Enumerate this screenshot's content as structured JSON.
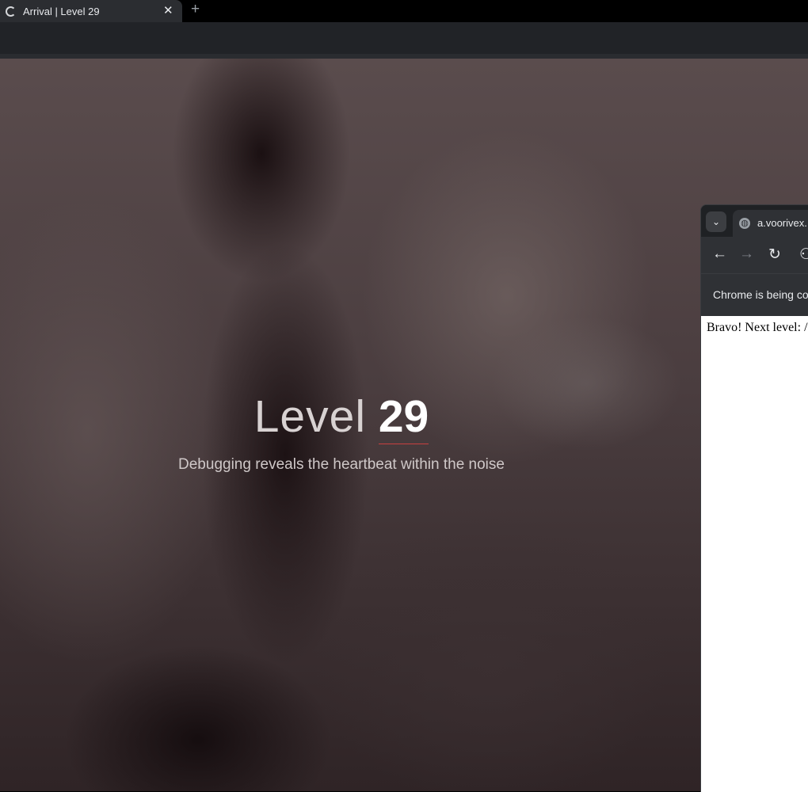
{
  "browser": {
    "tab": {
      "title": "Arrival | Level 29",
      "close_label": "✕"
    },
    "new_tab_label": "+"
  },
  "page": {
    "level_word": "Level",
    "level_number": "29",
    "subtitle": "Debugging reveals the heartbeat within the noise",
    "accent_color": "#c9403f"
  },
  "popup": {
    "tab_search_label": "⌄",
    "tab_title": "a.voorivex.",
    "globe_icon": "globe-icon",
    "back_label": "←",
    "forward_label": "→",
    "reload_label": "↻",
    "site_settings_label": "⚇",
    "info_bar_text": "Chrome is being co",
    "content_text": "Bravo! Next level: /"
  }
}
